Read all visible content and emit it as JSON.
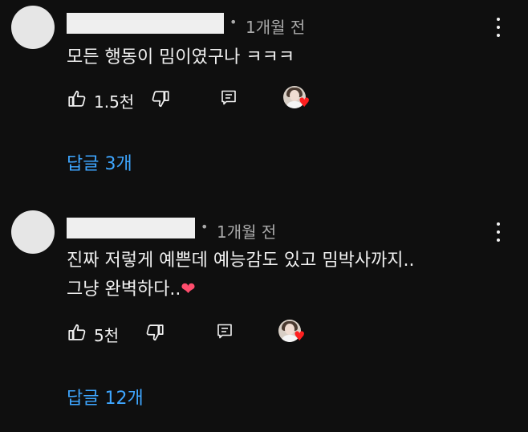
{
  "comments": [
    {
      "time": "1개월 전",
      "text_lines": [
        "모든 행동이 밈이였구나 ㅋㅋㅋ"
      ],
      "likes": "1.5천",
      "replies_label": "답글 3개"
    },
    {
      "time": "1개월 전",
      "text_lines": [
        "진짜 저렇게 예쁜데 예능감도 있고 밈박사까지..",
        "그냥 완벽하다..",
        "❤"
      ],
      "likes": "5천",
      "replies_label": "답글 12개"
    }
  ],
  "separator": "•",
  "icons": {
    "like": "thumbs-up-icon",
    "dislike": "thumbs-down-icon",
    "reply": "reply-icon",
    "menu": "more-vert-icon",
    "creator_heart": "creator-heart-icon"
  },
  "colors": {
    "background": "#0f0f0f",
    "link": "#3ea6ff",
    "heart": "#ff1f1f"
  }
}
